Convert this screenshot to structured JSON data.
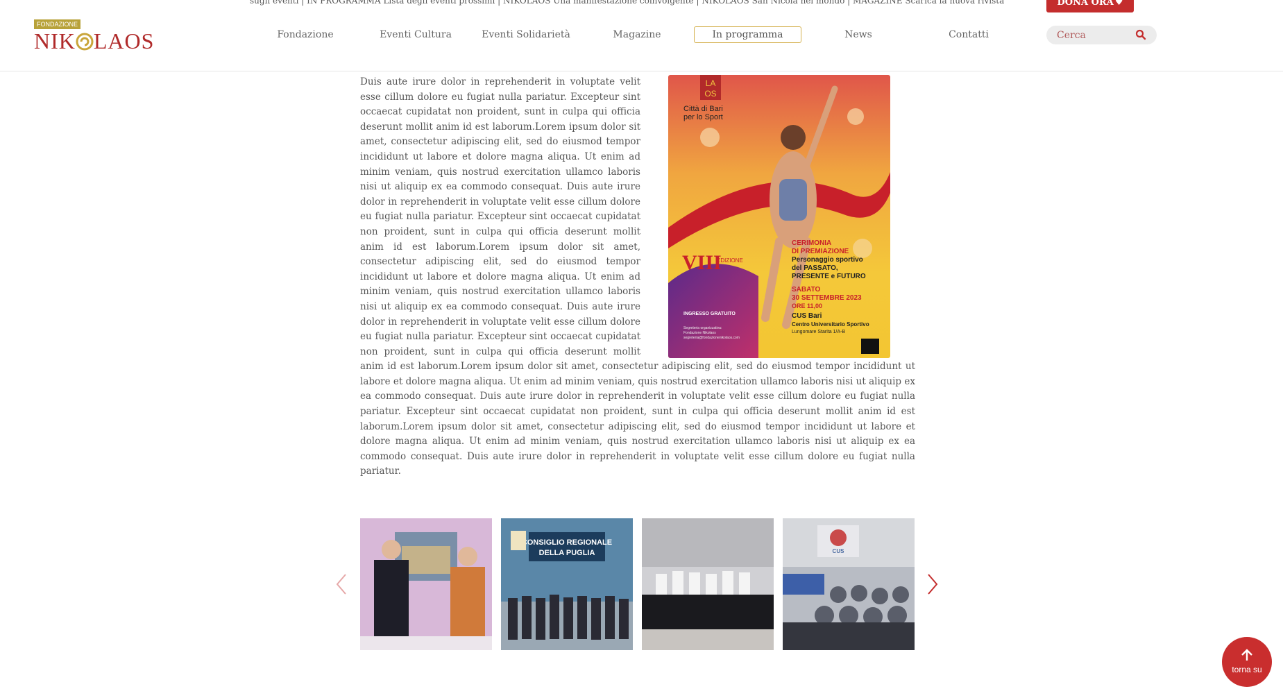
{
  "header": {
    "logo_badge": "FONDAZIONE",
    "logo_text_left": "NIK",
    "logo_text_right": "LAOS",
    "ticker": "sugli eventi | IN PROGRAMMA Lista degli eventi prossimi | NIKOLAOS Una manifestazione coinvolgente | NIKOLAOS San Nicola nel mondo | MAGAZINE Scarica la nuova rivista",
    "donate_label": "DONA ORA",
    "nav": [
      {
        "label": "Fondazione"
      },
      {
        "label": "Eventi Cultura"
      },
      {
        "label": "Eventi Solidarietà"
      },
      {
        "label": "Magazine"
      },
      {
        "label": "In programma"
      },
      {
        "label": "News"
      },
      {
        "label": "Contatti"
      }
    ],
    "search_placeholder": "Cerca"
  },
  "colors": {
    "brand_red": "#c42d2d",
    "accent_gold": "#d4b04c"
  },
  "article": {
    "text": "Duis aute irure dolor in reprehenderit in voluptate velit esse cillum dolore eu fugiat nulla pariatur. Excepteur sint occaecat cupidatat non proident, sunt in culpa qui officia deserunt mollit anim id est laborum.Lorem ipsum dolor sit amet, consectetur adipiscing elit, sed do eiusmod tempor incididunt ut labore et dolore magna aliqua. Ut enim ad minim veniam, quis nostrud exercitation ullamco laboris nisi ut aliquip ex ea commodo consequat. Duis aute irure dolor in reprehenderit in voluptate velit esse cillum dolore eu fugiat nulla pariatur. Excepteur sint occaecat cupidatat non proident, sunt in culpa qui officia deserunt mollit anim id est laborum.Lorem ipsum dolor sit amet, consectetur adipiscing elit, sed do eiusmod tempor incididunt ut labore et dolore magna aliqua. Ut enim ad minim veniam, quis nostrud exercitation ullamco laboris nisi ut aliquip ex ea commodo consequat. Duis aute irure dolor in reprehenderit in voluptate velit esse cillum dolore eu fugiat nulla pariatur. Excepteur sint occaecat cupidatat non proident, sunt in culpa qui officia deserunt mollit anim id est laborum.Lorem ipsum dolor sit amet, consectetur adipiscing elit, sed do eiusmod tempor incididunt ut labore et dolore magna aliqua. Ut enim ad minim veniam, quis nostrud exercitation ullamco laboris nisi ut aliquip ex ea commodo consequat. Duis aute irure dolor in reprehenderit in voluptate velit esse cillum dolore eu fugiat nulla pariatur. Excepteur sint occaecat cupidatat non proident, sunt in culpa qui officia deserunt mollit anim id est laborum.Lorem ipsum dolor sit amet, consectetur adipiscing elit, sed do eiusmod tempor incididunt ut labore et dolore magna aliqua. Ut enim ad minim veniam, quis nostrud exercitation ullamco laboris nisi ut aliquip ex ea commodo consequat. Duis aute irure dolor in reprehenderit in voluptate velit esse cillum dolore eu fugiat nulla pariatur."
  },
  "poster": {
    "brand_top": "LA",
    "brand_bottom": "OS",
    "city_line1": "Città di Bari",
    "city_line2": "per lo Sport",
    "edition_number": "VIII",
    "edition_word": "EDIZIONE",
    "ceremony_line1": "CERIMONIA",
    "ceremony_line2": "DI PREMIAZIONE",
    "award_line1": "Personaggio sportivo",
    "award_line2": "del PASSATO,",
    "award_line3": "PRESENTE e FUTURO",
    "day": "SABATO",
    "date": "30 SETTEMBRE 2023",
    "time": "ORE 11,00",
    "venue": "CUS Bari",
    "venue_full": "Centro Universitario Sportivo",
    "address": "Lungomare Starita 1/A-B",
    "entry": "INGRESSO GRATUITO",
    "organizer_line1": "Segreteria organizzativa:",
    "organizer_line2": "Fondazione Nikolaos",
    "organizer_line3": "segreteria@fondazionenikolaos.com"
  },
  "gallery": {
    "sign_line1": "CONSIGLIO REGIONALE",
    "sign_line2": "DELLA PUGLIA",
    "banner_text": "CUS"
  },
  "to_top": {
    "label": "torna su"
  }
}
